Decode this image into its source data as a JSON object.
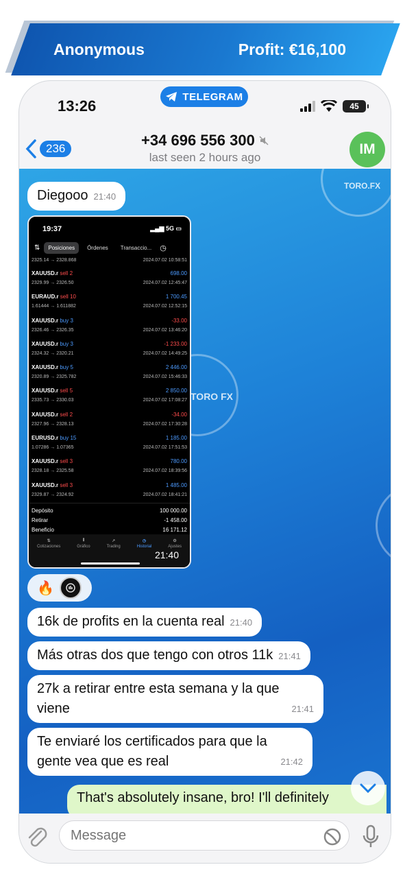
{
  "banner": {
    "name": "Anonymous",
    "profit": "Profit: €16,100"
  },
  "status_bar": {
    "time": "13:26",
    "telegram_label": "TELEGRAM",
    "battery": "45"
  },
  "header": {
    "back_count": "236",
    "contact": "+34 696 556 300",
    "last_seen": "last seen 2 hours ago",
    "avatar_initials": "IM"
  },
  "watermark": {
    "brand": "TORO.FX",
    "brand2": "TORO FX"
  },
  "messages": [
    {
      "text": "Diegooo",
      "time": "21:40"
    },
    {
      "text": "16k de profits en la cuenta real",
      "time": "21:40"
    },
    {
      "text": "Más otras dos que tengo con otros 11k",
      "time": "21:41"
    },
    {
      "text": "27k a retirar entre esta semana y la que viene",
      "time": "21:41"
    },
    {
      "text": "Te enviaré los certificados para que la gente vea que es real",
      "time": "21:42"
    }
  ],
  "image_message": {
    "time": "21:40"
  },
  "reactions": {
    "emoji": "🔥"
  },
  "outgoing": {
    "text": "That's absolutely insane, bro! I'll definitely"
  },
  "input": {
    "placeholder": "Message"
  },
  "screenshot": {
    "time": "19:37",
    "network": "5G",
    "tabs": [
      "Posiciones",
      "Órdenes",
      "Transaccio..."
    ],
    "first_row": {
      "prices": "2325.14 → 2328.868",
      "date": "2024.07.02 10:58:51"
    },
    "trades": [
      {
        "symbol": "XAUUSD.r",
        "side": "sell 2",
        "prices": "2329.99 → 2326.50",
        "value": "698.00",
        "date": "2024.07.02 12:45:47"
      },
      {
        "symbol": "EURAUD.r",
        "side": "sell 10",
        "prices": "1.61444 → 1.611882",
        "value": "1 700.45",
        "date": "2024.07.02 12:52:15"
      },
      {
        "symbol": "XAUUSD.r",
        "side": "buy 3",
        "prices": "2326.46 → 2326.35",
        "value": "-33.00",
        "date": "2024.07.02 13:46:20"
      },
      {
        "symbol": "XAUUSD.r",
        "side": "buy 3",
        "prices": "2324.32 → 2320.21",
        "value": "-1 233.00",
        "date": "2024.07.02 14:49:25"
      },
      {
        "symbol": "XAUUSD.r",
        "side": "buy 5",
        "prices": "2320.89 → 2325.782",
        "value": "2 446.00",
        "date": "2024.07.02 15:46:33"
      },
      {
        "symbol": "XAUUSD.r",
        "side": "sell 5",
        "prices": "2335.73 → 2330.03",
        "value": "2 850.00",
        "date": "2024.07.02 17:08:27"
      },
      {
        "symbol": "XAUUSD.r",
        "side": "sell 2",
        "prices": "2327.96 → 2328.13",
        "value": "-34.00",
        "date": "2024.07.02 17:30:28"
      },
      {
        "symbol": "EURUSD.r",
        "side": "buy 15",
        "prices": "1.07286 → 1.07365",
        "value": "1 185.00",
        "date": "2024.07.02 17:51:53"
      },
      {
        "symbol": "XAUUSD.r",
        "side": "sell 3",
        "prices": "2328.18 → 2325.58",
        "value": "780.00",
        "date": "2024.07.02 18:39:56"
      },
      {
        "symbol": "XAUUSD.r",
        "side": "sell 3",
        "prices": "2329.87 → 2324.92",
        "value": "1 485.00",
        "date": "2024.07.02 18:41:21"
      }
    ],
    "summary": [
      {
        "label": "Depósito",
        "value": "100 000.00"
      },
      {
        "label": "Retirar",
        "value": "-1 458.00"
      },
      {
        "label": "Beneficio",
        "value": "16 171.12"
      }
    ],
    "nav": [
      "Cotizaciones",
      "Gráfico",
      "Trading",
      "Historial",
      "Ajustes"
    ]
  }
}
